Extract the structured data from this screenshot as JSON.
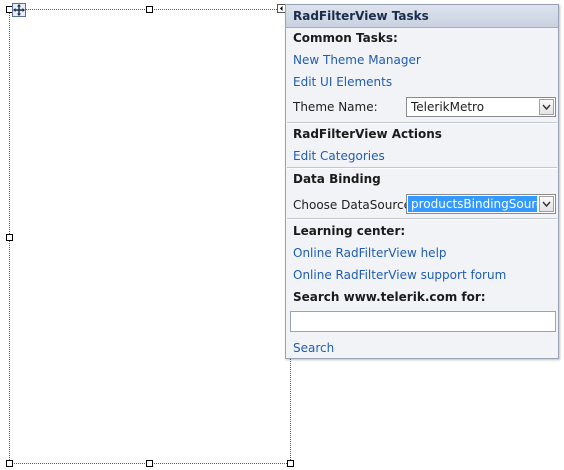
{
  "panel": {
    "title": "RadFilterView Tasks",
    "common_tasks_header": "Common Tasks:",
    "new_theme_manager": "New Theme Manager",
    "edit_ui_elements": "Edit UI Elements",
    "theme_name_label": "Theme Name:",
    "theme_name_value": "TelerikMetro",
    "actions_header": "RadFilterView Actions",
    "edit_categories": "Edit Categories",
    "data_binding_header": "Data Binding",
    "choose_datasource_label": "Choose DataSource",
    "datasource_value": "productsBindingSourc",
    "learning_center_header": "Learning center:",
    "online_help": "Online RadFilterView help",
    "support_forum": "Online RadFilterView support forum",
    "search_label": "Search www.telerik.com for:",
    "search_value": "",
    "search_link": "Search"
  },
  "icons": {
    "move": "move-icon",
    "smart_tag": "smart-tag-arrow-icon",
    "dropdown": "chevron-down-icon"
  },
  "colors": {
    "link": "#1f5db0",
    "selection": "#3399ff"
  }
}
